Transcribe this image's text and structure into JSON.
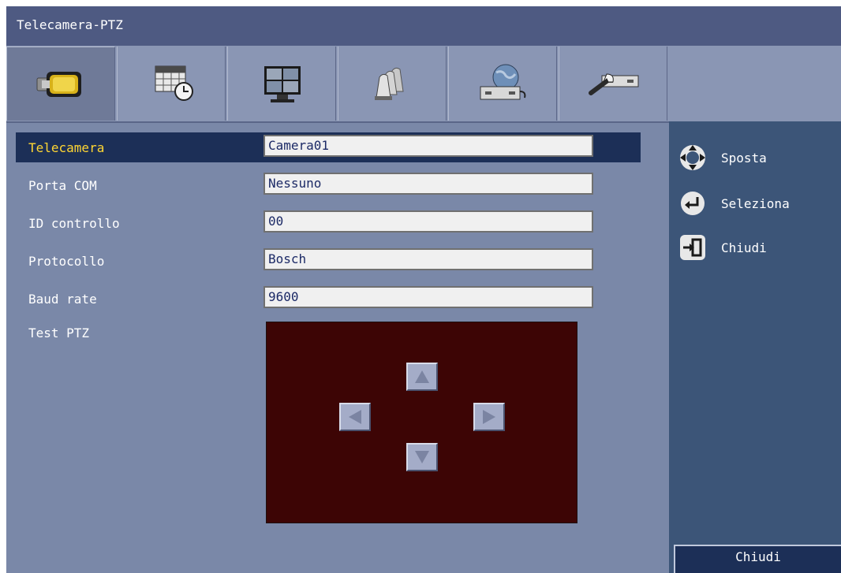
{
  "window": {
    "title": "Telecamera-PTZ"
  },
  "tabs": [
    {
      "icon": "camera-icon",
      "active": true
    },
    {
      "icon": "schedule-icon",
      "active": false
    },
    {
      "icon": "monitor-icon",
      "active": false
    },
    {
      "icon": "alarm-stack-icon",
      "active": false
    },
    {
      "icon": "network-icon",
      "active": false
    },
    {
      "icon": "system-tools-icon",
      "active": false
    }
  ],
  "form": {
    "rows": [
      {
        "label": "Telecamera",
        "value": "Camera01",
        "selected": true
      },
      {
        "label": "Porta COM",
        "value": "Nessuno",
        "selected": false
      },
      {
        "label": "ID controllo",
        "value": "00",
        "selected": false
      },
      {
        "label": "Protocollo",
        "value": "Bosch",
        "selected": false
      },
      {
        "label": "Baud rate",
        "value": "9600",
        "selected": false
      }
    ],
    "ptz_label": "Test PTZ"
  },
  "ptz": {
    "icons": [
      "arrow-up-icon",
      "arrow-left-icon",
      "arrow-right-icon",
      "arrow-down-icon"
    ]
  },
  "help": {
    "move_label": "Sposta",
    "select_label": "Seleziona",
    "close_label": "Chiudi"
  },
  "close_button_label": "Chiudi",
  "colors": {
    "titlebar": "#4e5a82",
    "background": "#7a88a8",
    "selected_row": "#1c2f57",
    "selected_label": "#ffd633",
    "ptz_pad": "#3d0505",
    "right_panel": "#3c5578"
  }
}
